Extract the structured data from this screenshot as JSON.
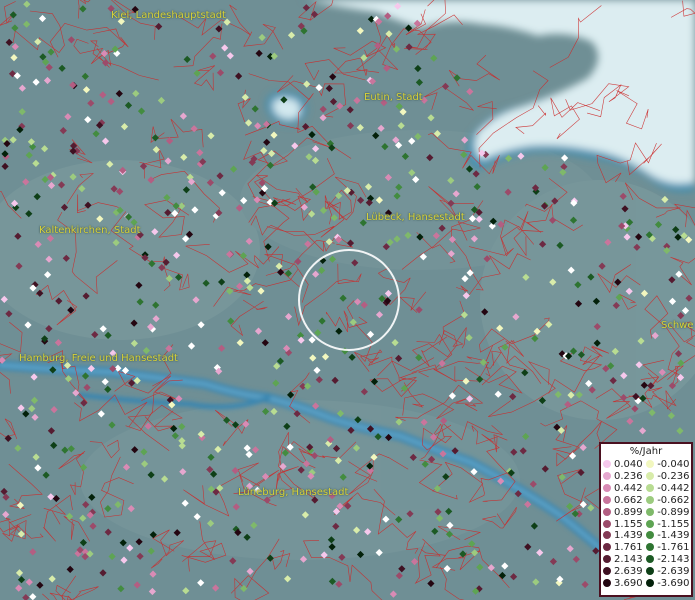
{
  "map": {
    "colors": {
      "land": "#6f8f95",
      "water": "#3a86b0",
      "sea": "#d9edf2",
      "borders": "#cc2a2a",
      "label": "#d8d23a"
    },
    "labels": [
      {
        "name": "label-kiel",
        "text": "Kiel, Landeshauptstadt"
      },
      {
        "name": "label-eutin",
        "text": "Eutin, Stadt"
      },
      {
        "name": "label-luebeck",
        "text": "Lübeck, Hansestadt"
      },
      {
        "name": "label-kaltenkirchen",
        "text": "Kaltenkirchen, Stadt"
      },
      {
        "name": "label-schwerin",
        "text": "Schwe"
      },
      {
        "name": "label-hamburg",
        "text": "Hamburg, Freie und Hansestadt"
      },
      {
        "name": "label-lueneburg",
        "text": "Lüneburg, Hansestadt"
      }
    ]
  },
  "legend": {
    "title": "%/Jahr",
    "positive": [
      {
        "label": "0.040",
        "color": "#f6c8ec"
      },
      {
        "label": "0.236",
        "color": "#e6a7cf"
      },
      {
        "label": "0.442",
        "color": "#d98bb5"
      },
      {
        "label": "0.662",
        "color": "#c9759c"
      },
      {
        "label": "0.899",
        "color": "#b35e82"
      },
      {
        "label": "1.155",
        "color": "#9c4b6a"
      },
      {
        "label": "1.439",
        "color": "#843a55"
      },
      {
        "label": "1.761",
        "color": "#6d2a43"
      },
      {
        "label": "2.143",
        "color": "#551c31"
      },
      {
        "label": "2.639",
        "color": "#3f1122"
      },
      {
        "label": "3.690",
        "color": "#240611"
      }
    ],
    "negative": [
      {
        "label": "-0.040",
        "color": "#f2f7bf"
      },
      {
        "label": "-0.236",
        "color": "#d8ecaa"
      },
      {
        "label": "-0.442",
        "color": "#b8dc92"
      },
      {
        "label": "-0.662",
        "color": "#9ccb7f"
      },
      {
        "label": "-0.899",
        "color": "#7fb96a"
      },
      {
        "label": "-1.155",
        "color": "#5ea453"
      },
      {
        "label": "-1.439",
        "color": "#438c40"
      },
      {
        "label": "-1.761",
        "color": "#2e7431"
      },
      {
        "label": "-2.143",
        "color": "#1c5a24"
      },
      {
        "label": "-2.639",
        "color": "#0e3f17"
      },
      {
        "label": "-3.690",
        "color": "#03210a"
      }
    ]
  }
}
